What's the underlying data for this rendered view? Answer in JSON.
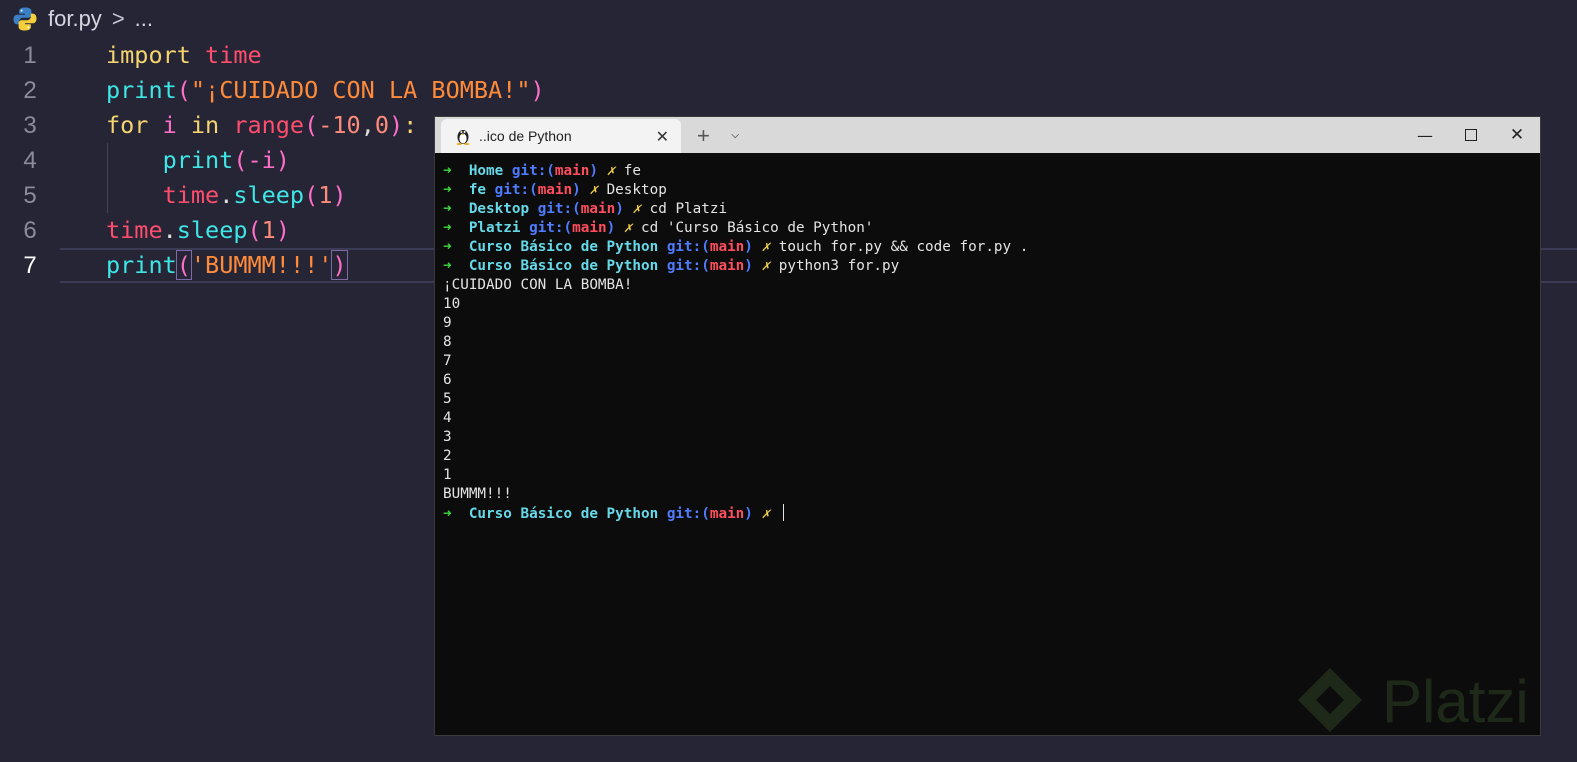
{
  "editor": {
    "breadcrumb": {
      "file": "for.py",
      "sep": ">",
      "ellipsis": "..."
    },
    "lines": [
      {
        "n": "1",
        "tokens": [
          {
            "t": "import ",
            "c": "kw"
          },
          {
            "t": "time",
            "c": "mod"
          }
        ]
      },
      {
        "n": "2",
        "tokens": [
          {
            "t": "print",
            "c": "fn"
          },
          {
            "t": "(",
            "c": "par"
          },
          {
            "t": "\"¡CUIDADO CON LA BOMBA!\"",
            "c": "str"
          },
          {
            "t": ")",
            "c": "par"
          }
        ]
      },
      {
        "n": "3",
        "tokens": [
          {
            "t": "for ",
            "c": "kw"
          },
          {
            "t": "i ",
            "c": "var"
          },
          {
            "t": "in ",
            "c": "kw"
          },
          {
            "t": "range",
            "c": "mod"
          },
          {
            "t": "(",
            "c": "par"
          },
          {
            "t": "-10",
            "c": "numc"
          },
          {
            "t": ",",
            "c": "punc"
          },
          {
            "t": "0",
            "c": "numc"
          },
          {
            "t": ")",
            "c": "par"
          },
          {
            "t": ":",
            "c": "kw"
          }
        ]
      },
      {
        "n": "4",
        "tokens": [
          {
            "t": "    ",
            "c": "punc"
          },
          {
            "t": "print",
            "c": "fn"
          },
          {
            "t": "(",
            "c": "par"
          },
          {
            "t": "-i",
            "c": "var"
          },
          {
            "t": ")",
            "c": "par"
          }
        ]
      },
      {
        "n": "5",
        "tokens": [
          {
            "t": "    ",
            "c": "punc"
          },
          {
            "t": "time",
            "c": "mod"
          },
          {
            "t": ".",
            "c": "punc"
          },
          {
            "t": "sleep",
            "c": "fn"
          },
          {
            "t": "(",
            "c": "par"
          },
          {
            "t": "1",
            "c": "numc"
          },
          {
            "t": ")",
            "c": "par"
          }
        ]
      },
      {
        "n": "6",
        "tokens": [
          {
            "t": "time",
            "c": "mod"
          },
          {
            "t": ".",
            "c": "punc"
          },
          {
            "t": "sleep",
            "c": "fn"
          },
          {
            "t": "(",
            "c": "par"
          },
          {
            "t": "1",
            "c": "numc"
          },
          {
            "t": ")",
            "c": "par"
          }
        ]
      },
      {
        "n": "7",
        "tokens": [
          {
            "t": "print",
            "c": "fn"
          },
          {
            "t": "(",
            "c": "par",
            "box": true
          },
          {
            "t": "'BUMMM!!!'",
            "c": "str"
          },
          {
            "t": ")",
            "c": "par",
            "box": true
          }
        ]
      }
    ],
    "active_line": "7"
  },
  "terminal": {
    "tab_title": "..ico de Python",
    "tab_close": "✕",
    "new_tab": "+",
    "dropdown": "⌵",
    "minimize": "—",
    "close": "✕",
    "lines": [
      {
        "type": "prompt",
        "dir": "Home",
        "cmd": "fe"
      },
      {
        "type": "prompt",
        "dir": "fe",
        "cmd": "Desktop"
      },
      {
        "type": "prompt",
        "dir": "Desktop",
        "cmd": "cd Platzi"
      },
      {
        "type": "prompt",
        "dir": "Platzi",
        "cmd": "cd 'Curso Básico de Python'"
      },
      {
        "type": "prompt",
        "dir": "Curso Básico de Python",
        "cmd": "touch for.py && code for.py ."
      },
      {
        "type": "prompt",
        "dir": "Curso Básico de Python",
        "cmd": "python3 for.py"
      },
      {
        "type": "out",
        "text": "¡CUIDADO CON LA BOMBA!"
      },
      {
        "type": "out",
        "text": "10"
      },
      {
        "type": "out",
        "text": "9"
      },
      {
        "type": "out",
        "text": "8"
      },
      {
        "type": "out",
        "text": "7"
      },
      {
        "type": "out",
        "text": "6"
      },
      {
        "type": "out",
        "text": "5"
      },
      {
        "type": "out",
        "text": "4"
      },
      {
        "type": "out",
        "text": "3"
      },
      {
        "type": "out",
        "text": "2"
      },
      {
        "type": "out",
        "text": "1"
      },
      {
        "type": "out",
        "text": "BUMMM!!!"
      },
      {
        "type": "prompt",
        "dir": "Curso Básico de Python",
        "cmd": "",
        "cursor": true
      }
    ],
    "prompt_parts": {
      "arrow": "➜",
      "git": "git:(",
      "branch": "main",
      "git_close": ")",
      "dirty": "✗"
    }
  },
  "watermark": {
    "text": "Platzi"
  },
  "colors": {
    "editor_bg": "#252536",
    "terminal_bg": "#0c0c0c",
    "accent_cyan": "#3fe6e6",
    "accent_pink": "#ff6ec7"
  }
}
